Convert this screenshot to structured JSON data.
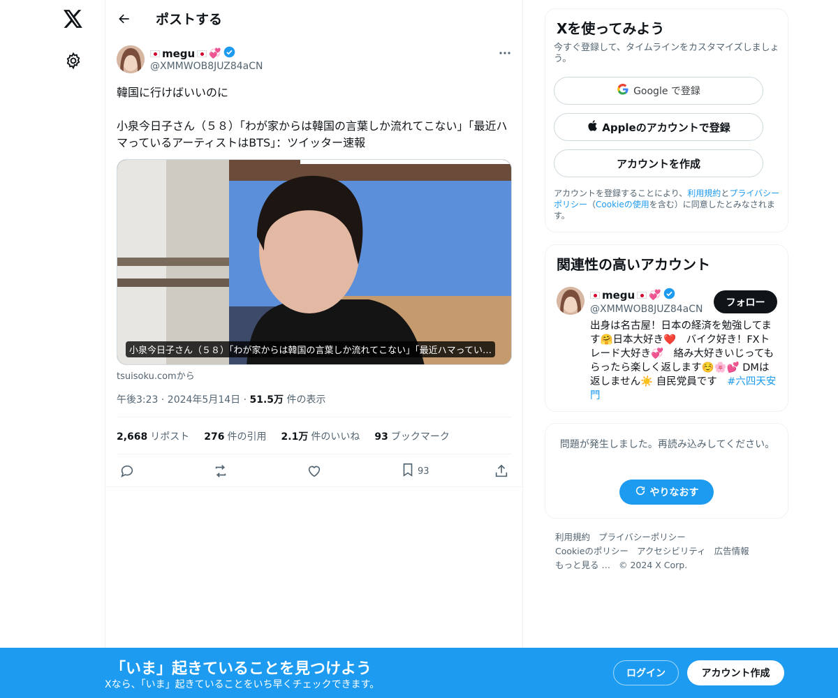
{
  "header": {
    "title": "ポストする"
  },
  "post": {
    "author_name": "megu",
    "author_handle": "@XMMWOB8JUZ84aCN",
    "text": "韓国に行けばいいのに\n\n小泉今日子さん（５８）「わが家からは韓国の言葉しか流れてこない」「最近ハマっているアーティストはBTS」：ツイッター速報",
    "media_caption": "小泉今日子さん（５８）「わが家からは韓国の言葉しか流れてこない」「最近ハマってい…",
    "source": "tsuisoku.comから",
    "time": "午後3:23 · 2024年5月14日",
    "views_count": "51.5万",
    "views_label": "件の表示",
    "stats": [
      {
        "count": "2,668",
        "label": "リポスト"
      },
      {
        "count": "276",
        "label": "件の引用"
      },
      {
        "count": "2.1万",
        "label": "件のいいね"
      },
      {
        "count": "93",
        "label": "ブックマーク"
      }
    ],
    "bookmark_count": "93"
  },
  "signup": {
    "title": "Xを使ってみよう",
    "subtitle": "今すぐ登録して、タイムラインをカスタマイズしましょう。",
    "google_label": "Google で登録",
    "apple_label": "Appleのアカウントで登録",
    "create_label": "アカウントを作成",
    "legal_pre": "アカウントを登録することにより、",
    "legal_terms": "利用規約",
    "legal_and": "と",
    "legal_privacy": "プライバシーポリシー",
    "legal_mid": "（",
    "legal_cookie": "Cookieの使用",
    "legal_post": "を含む）に同意したとみなされます。"
  },
  "related": {
    "title": "関連性の高いアカウント",
    "name": "megu",
    "handle": "@XMMWOB8JUZ84aCN",
    "follow_label": "フォロー",
    "bio": "出身は名古屋！日本の経済を勉強してます🤗日本大好き❤️　バイク好き！FXトレード大好き💞　絡み大好きいじってもらったら楽しく返します☺️🌸💕 DMは返しません☀️ 自民党員です　",
    "bio_tag": "#六四天安門"
  },
  "error": {
    "text": "問題が発生しました。再読み込みしてください。",
    "retry_label": "やりなおす"
  },
  "footer": {
    "links": [
      "利用規約",
      "プライバシーポリシー",
      "Cookieのポリシー",
      "アクセシビリティ",
      "広告情報",
      "もっと見る …",
      "© 2024 X Corp."
    ]
  },
  "bottombar": {
    "title": "「いま」起きていることを見つけよう",
    "subtitle": "Xなら、「いま」起きていることをいち早くチェックできます。",
    "login_label": "ログイン",
    "create_label": "アカウント作成"
  },
  "colors": {
    "accent": "#1d9bf0",
    "text": "#0f1419",
    "muted": "#536471",
    "border": "#eff3f4"
  },
  "icons": [
    "x-logo-icon",
    "settings-gear-icon",
    "back-arrow-icon",
    "verified-badge-icon",
    "more-icon",
    "reply-icon",
    "repost-icon",
    "like-icon",
    "bookmark-icon",
    "share-icon",
    "google-icon",
    "apple-icon",
    "refresh-icon"
  ]
}
